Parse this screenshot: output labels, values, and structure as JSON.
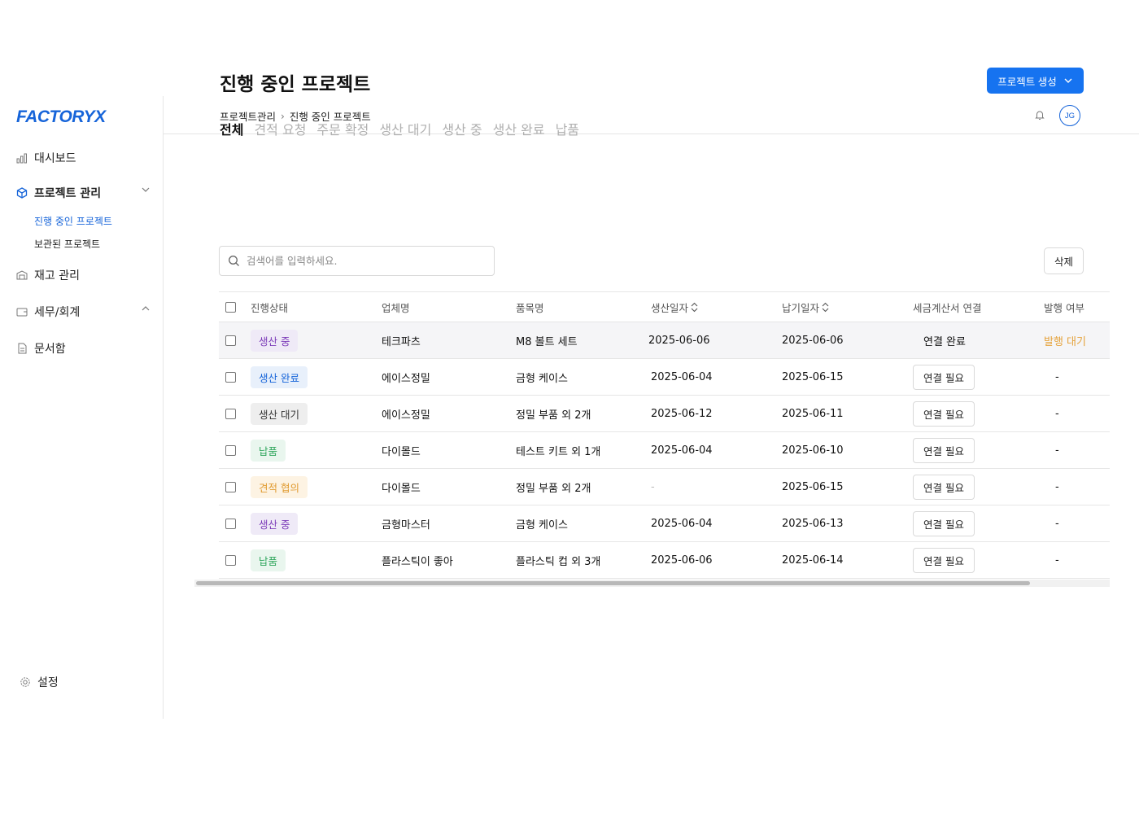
{
  "sidebar": {
    "logo": "FACTORYX",
    "items": [
      {
        "label": "대시보드",
        "icon": "bar-chart-icon"
      },
      {
        "label": "프로젝트 관리",
        "icon": "cube-icon"
      },
      {
        "label": "재고 관리",
        "icon": "warehouse-icon"
      },
      {
        "label": "세무/회계",
        "icon": "wallet-icon"
      },
      {
        "label": "문서함",
        "icon": "document-icon"
      }
    ],
    "sub_items": [
      {
        "label": "진행 중인 프로젝트",
        "active": true
      },
      {
        "label": "보관된 프로젝트",
        "active": false
      }
    ],
    "settings_label": "설정"
  },
  "header": {
    "breadcrumb": [
      "프로젝트관리",
      "진행 중인 프로젝트"
    ],
    "avatar_initials": "JG"
  },
  "main": {
    "title": "진행 중인 프로젝트",
    "create_button": "프로젝트 생성",
    "tabs": [
      "전체",
      "견적 요청",
      "주문 확정",
      "생산 대기",
      "생산 중",
      "생산 완료",
      "납품"
    ],
    "search_placeholder": "검색어를 입력하세요.",
    "delete_button": "삭제"
  },
  "table": {
    "columns": [
      "진행상태",
      "업체명",
      "품목명",
      "생산일자",
      "납기일자",
      "세금계산서 연결",
      "발행 여부"
    ],
    "rows": [
      {
        "status": "생산 중",
        "company": "테크파츠",
        "item": "M8 볼트 세트",
        "prod_date": "2025-06-06",
        "due_date": "2025-06-06",
        "invoice": "연결 완료",
        "issued": "발행 대기"
      },
      {
        "status": "생산 완료",
        "company": "에이스정밀",
        "item": "금형 케이스",
        "prod_date": "2025-06-04",
        "due_date": "2025-06-15",
        "invoice": "연결 필요",
        "issued": "-"
      },
      {
        "status": "생산 대기",
        "company": "에이스정밀",
        "item": "정밀 부품 외 2개",
        "prod_date": "2025-06-12",
        "due_date": "2025-06-11",
        "invoice": "연결 필요",
        "issued": "-"
      },
      {
        "status": "납품",
        "company": "다이몰드",
        "item": "테스트 키트 외 1개",
        "prod_date": "2025-06-04",
        "due_date": "2025-06-10",
        "invoice": "연결 필요",
        "issued": "-"
      },
      {
        "status": "견적 협의",
        "company": "다이몰드",
        "item": "정밀 부품 외 2개",
        "prod_date": "-",
        "due_date": "2025-06-15",
        "invoice": "연결 필요",
        "issued": "-"
      },
      {
        "status": "생산 중",
        "company": "금형마스터",
        "item": "금형 케이스",
        "prod_date": "2025-06-04",
        "due_date": "2025-06-13",
        "invoice": "연결 필요",
        "issued": "-"
      },
      {
        "status": "납품",
        "company": "플라스틱이 좋아",
        "item": "플라스틱 컵 외 3개",
        "prod_date": "2025-06-06",
        "due_date": "2025-06-14",
        "invoice": "연결 필요",
        "issued": "-"
      }
    ]
  },
  "colors": {
    "accent": "#1673f0",
    "brand": "#1664d9",
    "status_in_production": "#7b3ab8",
    "status_complete": "#1664d9",
    "status_delivered": "#2fa65c",
    "status_quote": "#e09a2f",
    "issue_pending": "#e5a23a"
  }
}
